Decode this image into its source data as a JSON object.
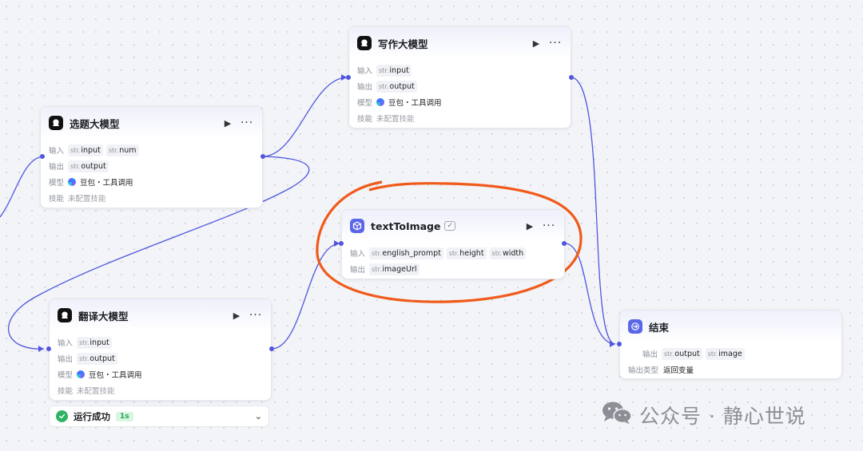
{
  "nodes": {
    "topic": {
      "title": "选题大模型"
    },
    "write": {
      "title": "写作大模型"
    },
    "translate": {
      "title": "翻译大模型"
    },
    "tti": {
      "title": "textToImage"
    },
    "end": {
      "title": "结束"
    }
  },
  "labels": {
    "input": "输入",
    "output": "输出",
    "model": "模型",
    "skill": "技能",
    "output_type": "输出类型",
    "type_prefix": "str."
  },
  "values": {
    "input": "input",
    "num": "num",
    "output": "output",
    "english_prompt": "english_prompt",
    "height": "height",
    "width": "width",
    "imageUrl": "imageUrl",
    "image": "image",
    "model_name": "豆包・工具调用",
    "no_skill": "未配置技能",
    "return_var": "返回变量"
  },
  "status": {
    "text": "运行成功",
    "duration": "1s"
  },
  "watermark": {
    "text": "公众号 · 静心世说"
  },
  "colors": {
    "edge": "#5056e0",
    "annotation_circle": "#f05a1a",
    "success": "#2fb363"
  },
  "icons": {
    "run": "play-icon",
    "more": "more-icon",
    "expand": "chevron-down-icon"
  }
}
